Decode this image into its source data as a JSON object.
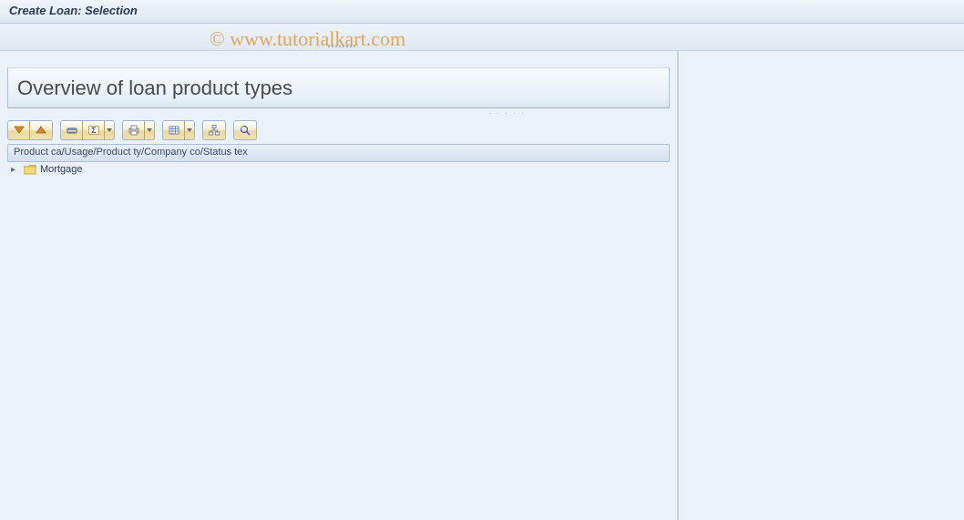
{
  "header": {
    "title": "Create Loan: Selection"
  },
  "watermark": "© www.tutorialkart.com",
  "panel": {
    "heading": "Overview of loan product types",
    "column_header": "Product ca/Usage/Product ty/Company co/Status tex"
  },
  "toolbar": {
    "groups": [
      {
        "buttons": [
          {
            "name": "expand-all-icon"
          },
          {
            "name": "collapse-all-icon"
          }
        ]
      },
      {
        "buttons": [
          {
            "name": "find-icon"
          },
          {
            "name": "sum-icon"
          },
          {
            "name": "dropdown-icon",
            "narrow": true
          }
        ]
      },
      {
        "buttons": [
          {
            "name": "print-icon"
          },
          {
            "name": "dropdown-icon",
            "narrow": true
          }
        ]
      },
      {
        "buttons": [
          {
            "name": "layout-icon"
          },
          {
            "name": "dropdown-icon",
            "narrow": true
          }
        ]
      },
      {
        "buttons": [
          {
            "name": "hierarchy-icon"
          }
        ]
      },
      {
        "buttons": [
          {
            "name": "detail-icon"
          }
        ]
      }
    ]
  },
  "tree": {
    "items": [
      {
        "label": "Mortgage",
        "expanded": false
      }
    ]
  }
}
